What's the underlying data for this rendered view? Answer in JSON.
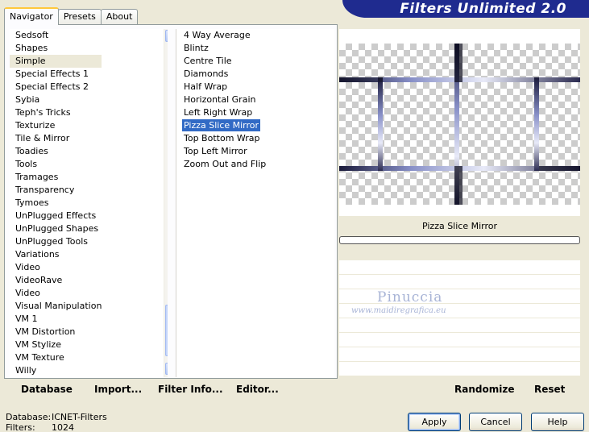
{
  "banner": {
    "title": "Filters Unlimited 2.0"
  },
  "tabs": [
    {
      "label": "Navigator",
      "active": true
    },
    {
      "label": "Presets",
      "active": false
    },
    {
      "label": "About",
      "active": false
    }
  ],
  "categories": {
    "items": [
      "Sedsoft",
      "Shapes",
      "Simple",
      "Special Effects 1",
      "Special Effects 2",
      "Sybia",
      "Teph's Tricks",
      "Texturize",
      "Tile & Mirror",
      "Toadies",
      "Tools",
      "Tramages",
      "Transparency",
      "Tymoes",
      "UnPlugged Effects",
      "UnPlugged Shapes",
      "UnPlugged Tools",
      "Variations",
      "Video",
      "VideoRave",
      "Video",
      "Visual Manipulation",
      "VM 1",
      "VM Distortion",
      "VM Stylize",
      "VM Texture",
      "Willy"
    ],
    "selected": "Simple"
  },
  "filters": {
    "items": [
      "4 Way Average",
      "Blintz",
      "Centre Tile",
      "Diamonds",
      "Half Wrap",
      "Horizontal Grain",
      "Left Right Wrap",
      "Pizza Slice Mirror",
      "Top Bottom Wrap",
      "Top Left Mirror",
      "Zoom Out and Flip"
    ],
    "selected": "Pizza Slice Mirror"
  },
  "preview": {
    "filter_name": "Pizza Slice Mirror"
  },
  "watermark": {
    "name": "Pinuccia",
    "url": "www.maidiregrafica.eu"
  },
  "toolbar": {
    "database": "Database",
    "import": "Import...",
    "filter_info": "Filter Info...",
    "editor": "Editor...",
    "randomize": "Randomize",
    "reset": "Reset"
  },
  "info": {
    "database_label": "Database:",
    "database_value": "ICNET-Filters",
    "filters_label": "Filters:",
    "filters_value": "1024"
  },
  "buttons": {
    "apply": "Apply",
    "cancel": "Cancel",
    "help": "Help"
  }
}
